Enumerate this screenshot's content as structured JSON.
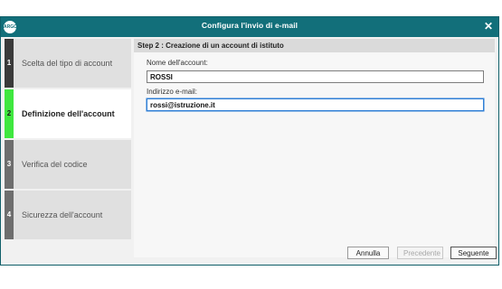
{
  "window": {
    "title": "Configura l'invio di e-mail",
    "logo_text": "ARGO",
    "close_glyph": "✕",
    "icons": [
      "app-logo-icon",
      "close-icon"
    ]
  },
  "sidebar": {
    "steps": [
      {
        "number": "1",
        "label": "Scelta del tipo di account",
        "state": "done"
      },
      {
        "number": "2",
        "label": "Definizione dell'account",
        "state": "active"
      },
      {
        "number": "3",
        "label": "Verifica del codice",
        "state": "pending"
      },
      {
        "number": "4",
        "label": "Sicurezza dell'account",
        "state": "pending"
      }
    ]
  },
  "content": {
    "header": "Step 2 : Creazione di un account di istituto",
    "fields": [
      {
        "label": "Nome dell'account:",
        "value": "ROSSI"
      },
      {
        "label": "Indirizzo e-mail:",
        "value": "rossi@istruzione.it"
      }
    ]
  },
  "buttons": {
    "cancel": "Annulla",
    "previous": "Precedente",
    "next": "Seguente"
  },
  "colors": {
    "titlebar": "#126f7a",
    "active_step": "#3fe73f"
  }
}
